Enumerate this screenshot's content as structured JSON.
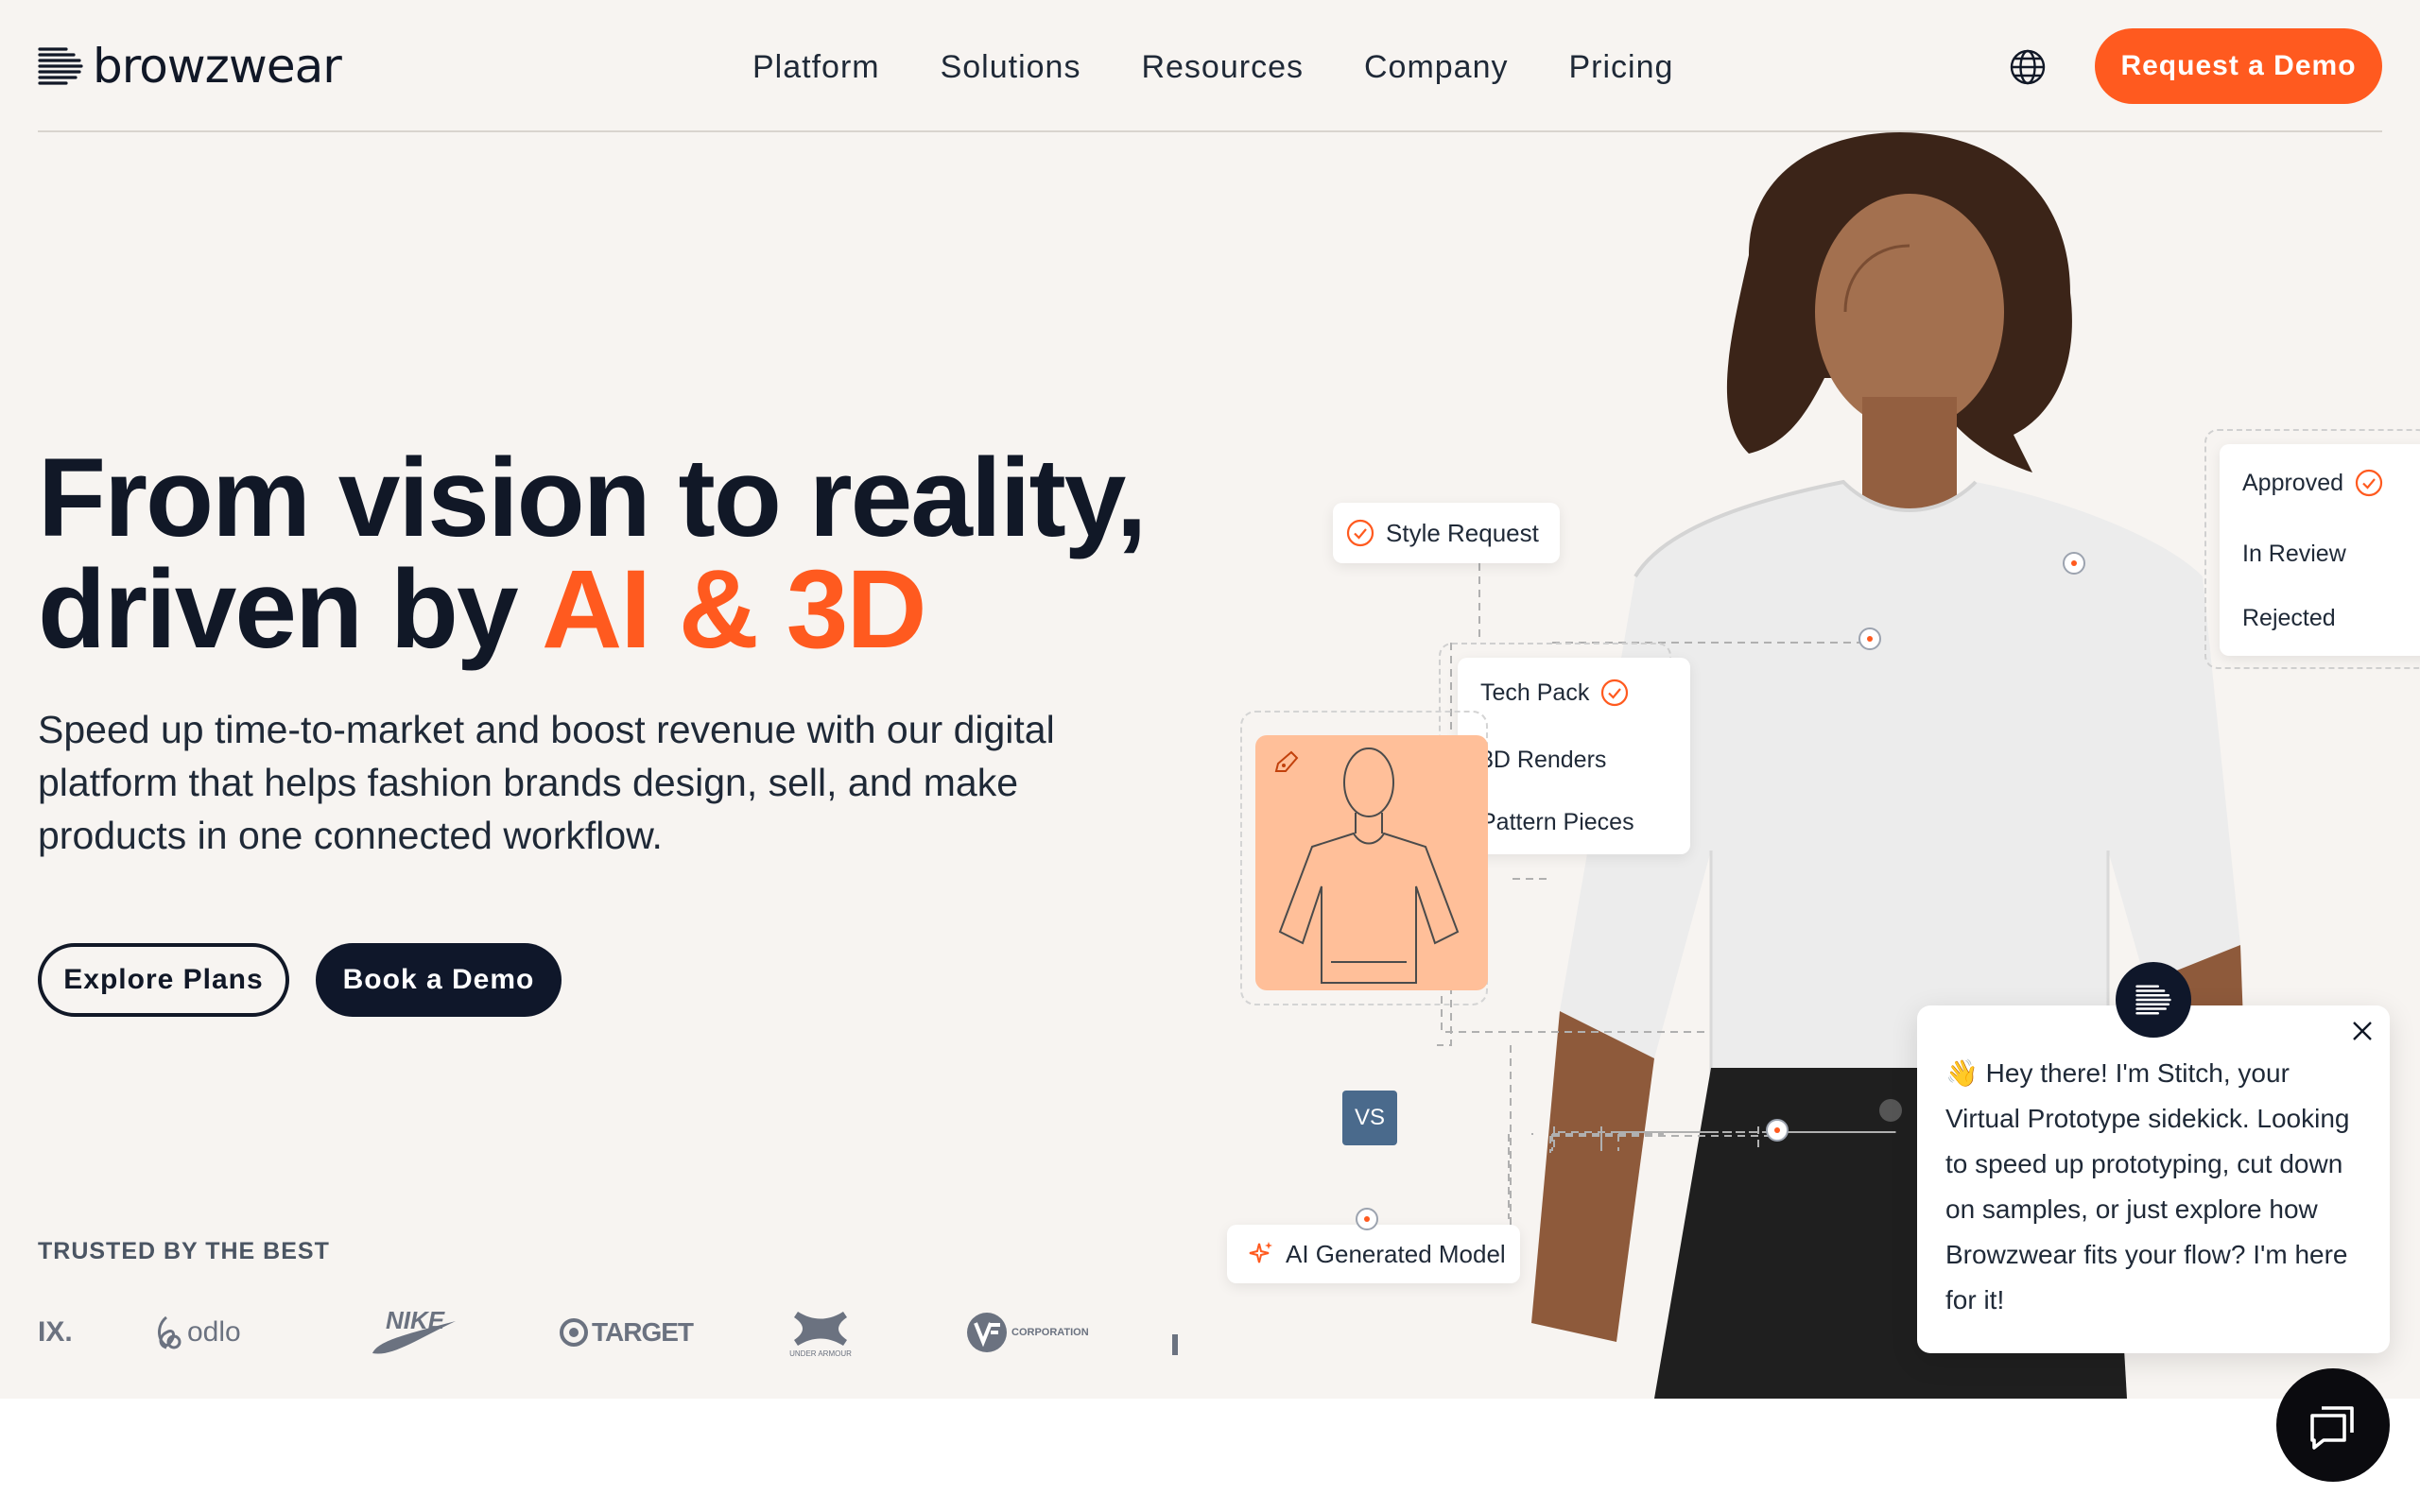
{
  "brand": {
    "name": "browzwear"
  },
  "nav": {
    "items": [
      "Platform",
      "Solutions",
      "Resources",
      "Company",
      "Pricing"
    ],
    "cta": "Request a Demo"
  },
  "hero": {
    "headline_line1": "From vision to reality,",
    "headline_line2_prefix": "driven by ",
    "headline_line2_accent": "AI & 3D",
    "subhead": "Speed up time-to-market and boost revenue with our digital platform that helps fashion brands design, sell, and make products in one connected workflow.",
    "btn_explore": "Explore Plans",
    "btn_book": "Book a Demo"
  },
  "trusted": {
    "label": "TRUSTED BY THE BEST",
    "brands": [
      "IX.",
      "odlo",
      "NIKE",
      "TARGET",
      "UNDER ARMOUR",
      "CORPORATION"
    ]
  },
  "visual": {
    "style_request": "Style Request",
    "tech_pack": "Tech Pack",
    "renders_3d": "3D Renders",
    "pattern_pieces": "Pattern Pieces",
    "vs_label": "VS",
    "ai_model": "AI Generated Model",
    "status_approved": "Approved",
    "status_review": "In Review",
    "status_rejected": "Rejected"
  },
  "chat": {
    "emoji": "👋",
    "message": "Hey there! I'm Stitch, your Virtual Prototype sidekick. Looking to speed up prototyping, cut down on samples, or just explore how Browzwear fits your flow? I'm here for it!"
  },
  "colors": {
    "accent": "#ff5a1f",
    "dark": "#0f172a",
    "hero_bg": "#f7f4f1"
  }
}
